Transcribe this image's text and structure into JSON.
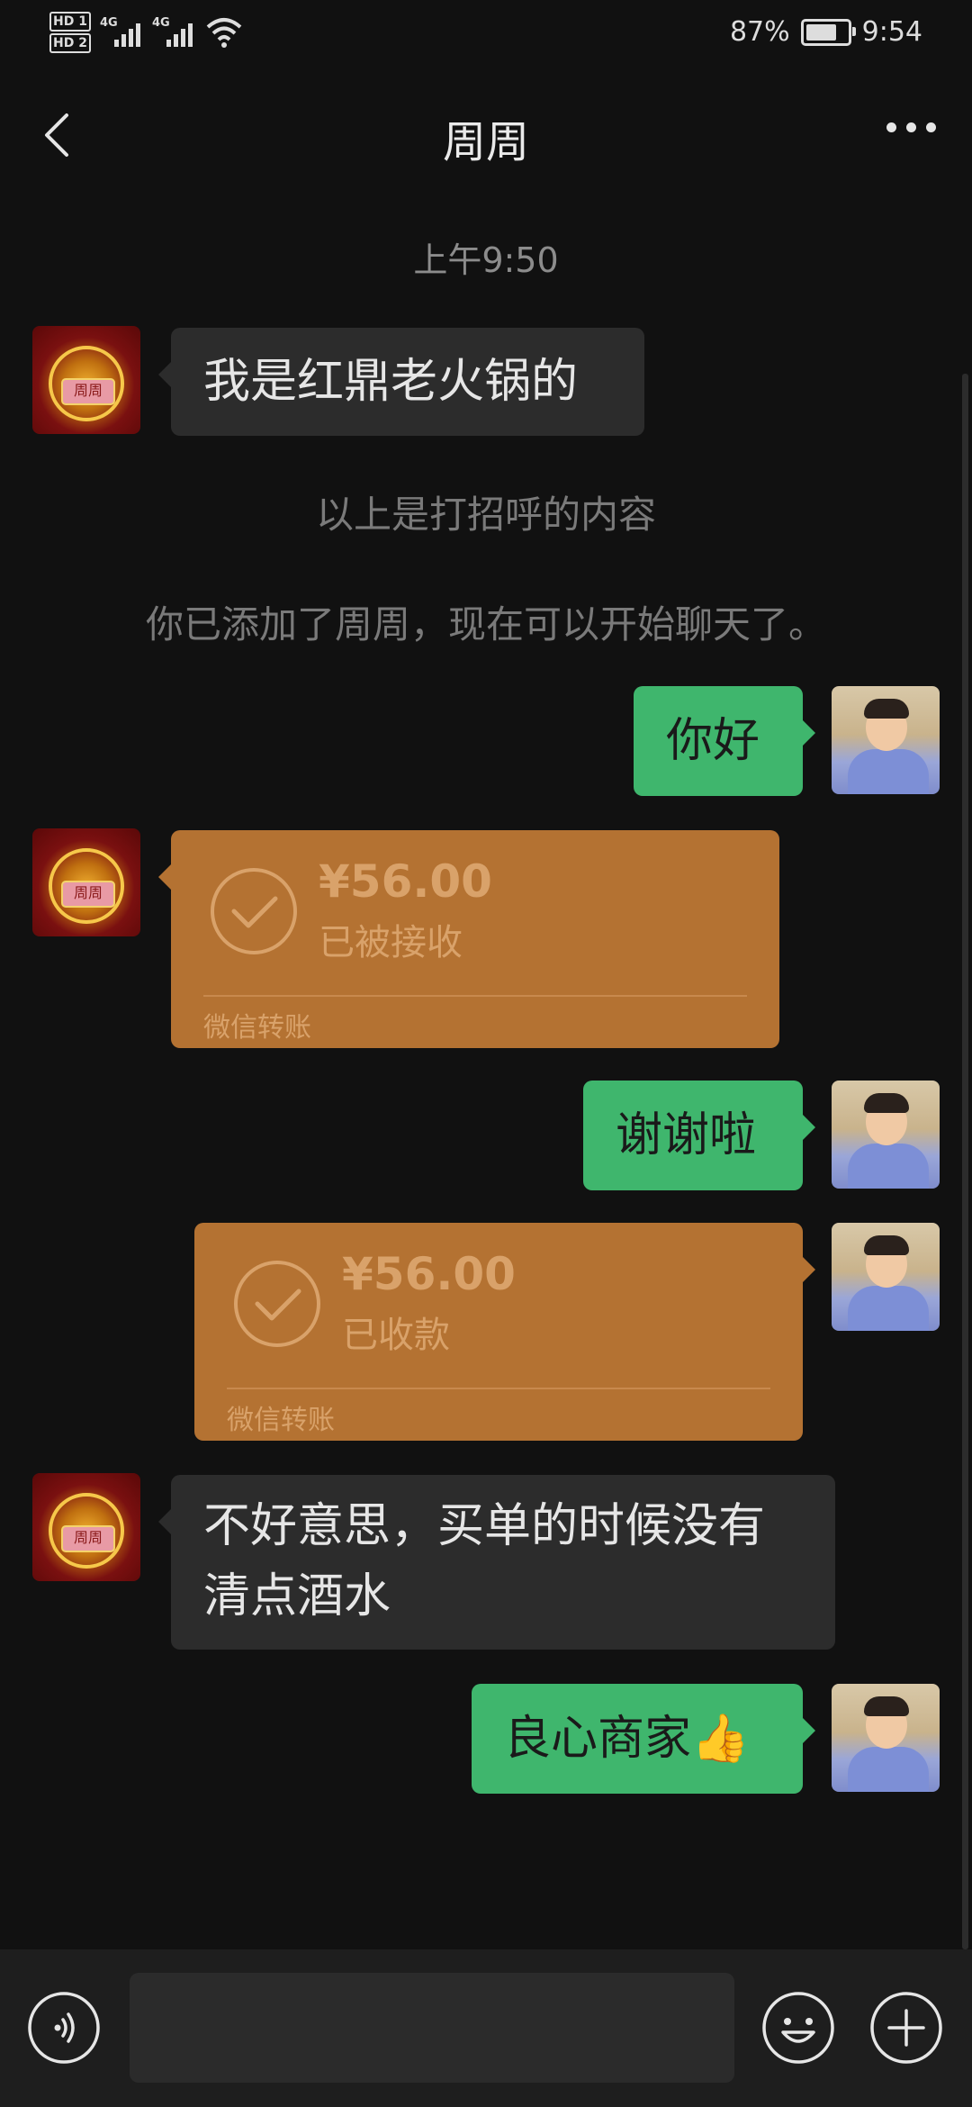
{
  "status_bar": {
    "hd1": "HD 1",
    "hd2": "HD 2",
    "net1": "4G",
    "net2": "4G",
    "battery": "87%",
    "battery_level": 0.87,
    "time": "9:54"
  },
  "header": {
    "title": "周周",
    "back_icon": "chevron-left-icon",
    "more_icon": "more-dots-icon"
  },
  "chat": {
    "timestamp": "上午9:50",
    "messages": [
      {
        "side": "left",
        "type": "text",
        "text": "我是红鼎老火锅的"
      },
      {
        "type": "system",
        "text": "以上是打招呼的内容"
      },
      {
        "type": "system",
        "text": "你已添加了周周，现在可以开始聊天了。"
      },
      {
        "side": "right",
        "type": "text",
        "text": "你好"
      },
      {
        "side": "left",
        "type": "transfer",
        "amount": "¥56.00",
        "status": "已被接收",
        "label": "微信转账"
      },
      {
        "side": "right",
        "type": "text",
        "text": "谢谢啦"
      },
      {
        "side": "right",
        "type": "transfer",
        "amount": "¥56.00",
        "status": "已收款",
        "label": "微信转账"
      },
      {
        "side": "left",
        "type": "text",
        "line1": "不好意思，买单的时候没有",
        "line2": "清点酒水"
      },
      {
        "side": "right",
        "type": "text",
        "text": "良心商家👍"
      }
    ],
    "shop_avatar_plate": "周周"
  },
  "input_bar": {
    "voice_icon": "voice-icon",
    "emoji_icon": "emoji-icon",
    "plus_icon": "plus-icon",
    "input_value": "",
    "placeholder": ""
  },
  "colors": {
    "background": "#111111",
    "bubble_gray": "#2c2c2c",
    "bubble_green": "#3fb66d",
    "transfer": "#b47232"
  }
}
